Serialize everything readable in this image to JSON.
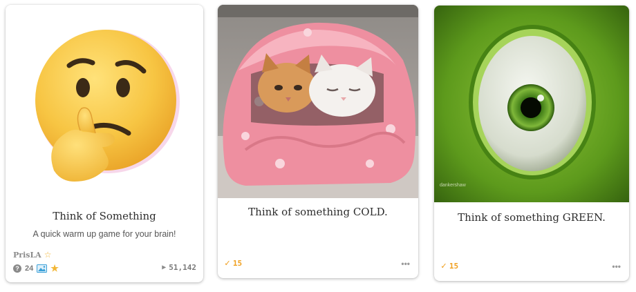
{
  "cards": [
    {
      "title": "Think of Something",
      "description": "A quick warm up game for your brain!",
      "author": "PrisLA",
      "question_count": "24",
      "plays": "51,142",
      "image_icon": "thinking-face-emoji"
    },
    {
      "title": "Think of something COLD.",
      "score": "15",
      "more_label": "•••",
      "image_icon": "cats-in-pink-blanket"
    },
    {
      "title": "Think of something GREEN.",
      "score": "15",
      "more_label": "•••",
      "image_icon": "green-eyeball"
    }
  ],
  "colors": {
    "accent_orange": "#f0a020",
    "star_yellow": "#f2b635",
    "muted_text": "#7a7a7a"
  }
}
